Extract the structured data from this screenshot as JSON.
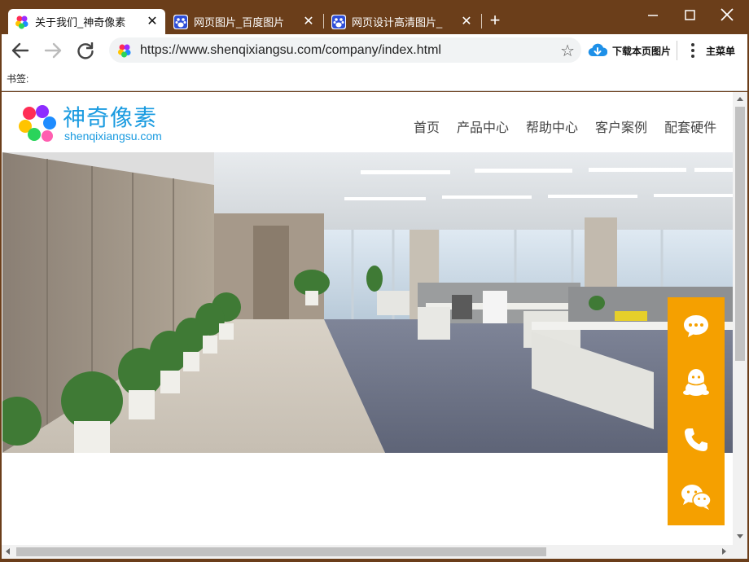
{
  "browser": {
    "tabs": [
      {
        "title": "关于我们_神奇像素",
        "active": true,
        "icon": "colorful-dots-icon"
      },
      {
        "title": "网页图片_百度图片",
        "active": false,
        "icon": "baidu-paw-icon"
      },
      {
        "title": "网页设计高清图片_",
        "active": false,
        "icon": "baidu-paw-icon"
      }
    ],
    "new_tab_label": "+",
    "address": "https://www.shenqixiangsu.com/company/index.html",
    "download_label": "下载本页图片",
    "menu_label": "主菜单",
    "bookmarks_label": "书签:"
  },
  "site": {
    "logo_cn": "神奇像素",
    "logo_en": "shenqixiangsu.com",
    "nav": [
      "首页",
      "产品中心",
      "帮助中心",
      "客户案例",
      "配套硬件"
    ],
    "side_actions": [
      "chat-bubble-icon",
      "qq-penguin-icon",
      "phone-icon",
      "wechat-icon"
    ]
  },
  "colors": {
    "frame": "#6b3e1a",
    "accent_blue": "#1a9be0",
    "side_panel": "#f5a000"
  }
}
